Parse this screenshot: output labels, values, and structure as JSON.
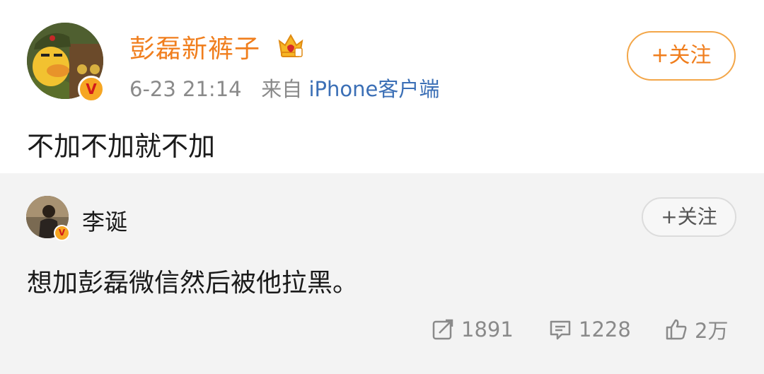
{
  "post": {
    "author_name": "彭磊新裤子",
    "timestamp": "6-23 21:14",
    "source_prefix": "来自",
    "source_name": "iPhone客户端",
    "follow_label": "+关注",
    "text": "不加不加就不加",
    "verified_badge": "V"
  },
  "repost": {
    "author_name": "李诞",
    "follow_label": "+关注",
    "text": "想加彭磊微信然后被他拉黑。",
    "verified_badge": "V"
  },
  "actions": {
    "repost_count": "1891",
    "comment_count": "1228",
    "like_count": "2万"
  },
  "colors": {
    "accent_orange": "#f07e1d",
    "link_blue": "#3b6fb6",
    "muted_gray": "#8a8a8a"
  },
  "icons": [
    "crown-icon",
    "verified-icon",
    "repost-icon",
    "comment-icon",
    "like-icon"
  ]
}
